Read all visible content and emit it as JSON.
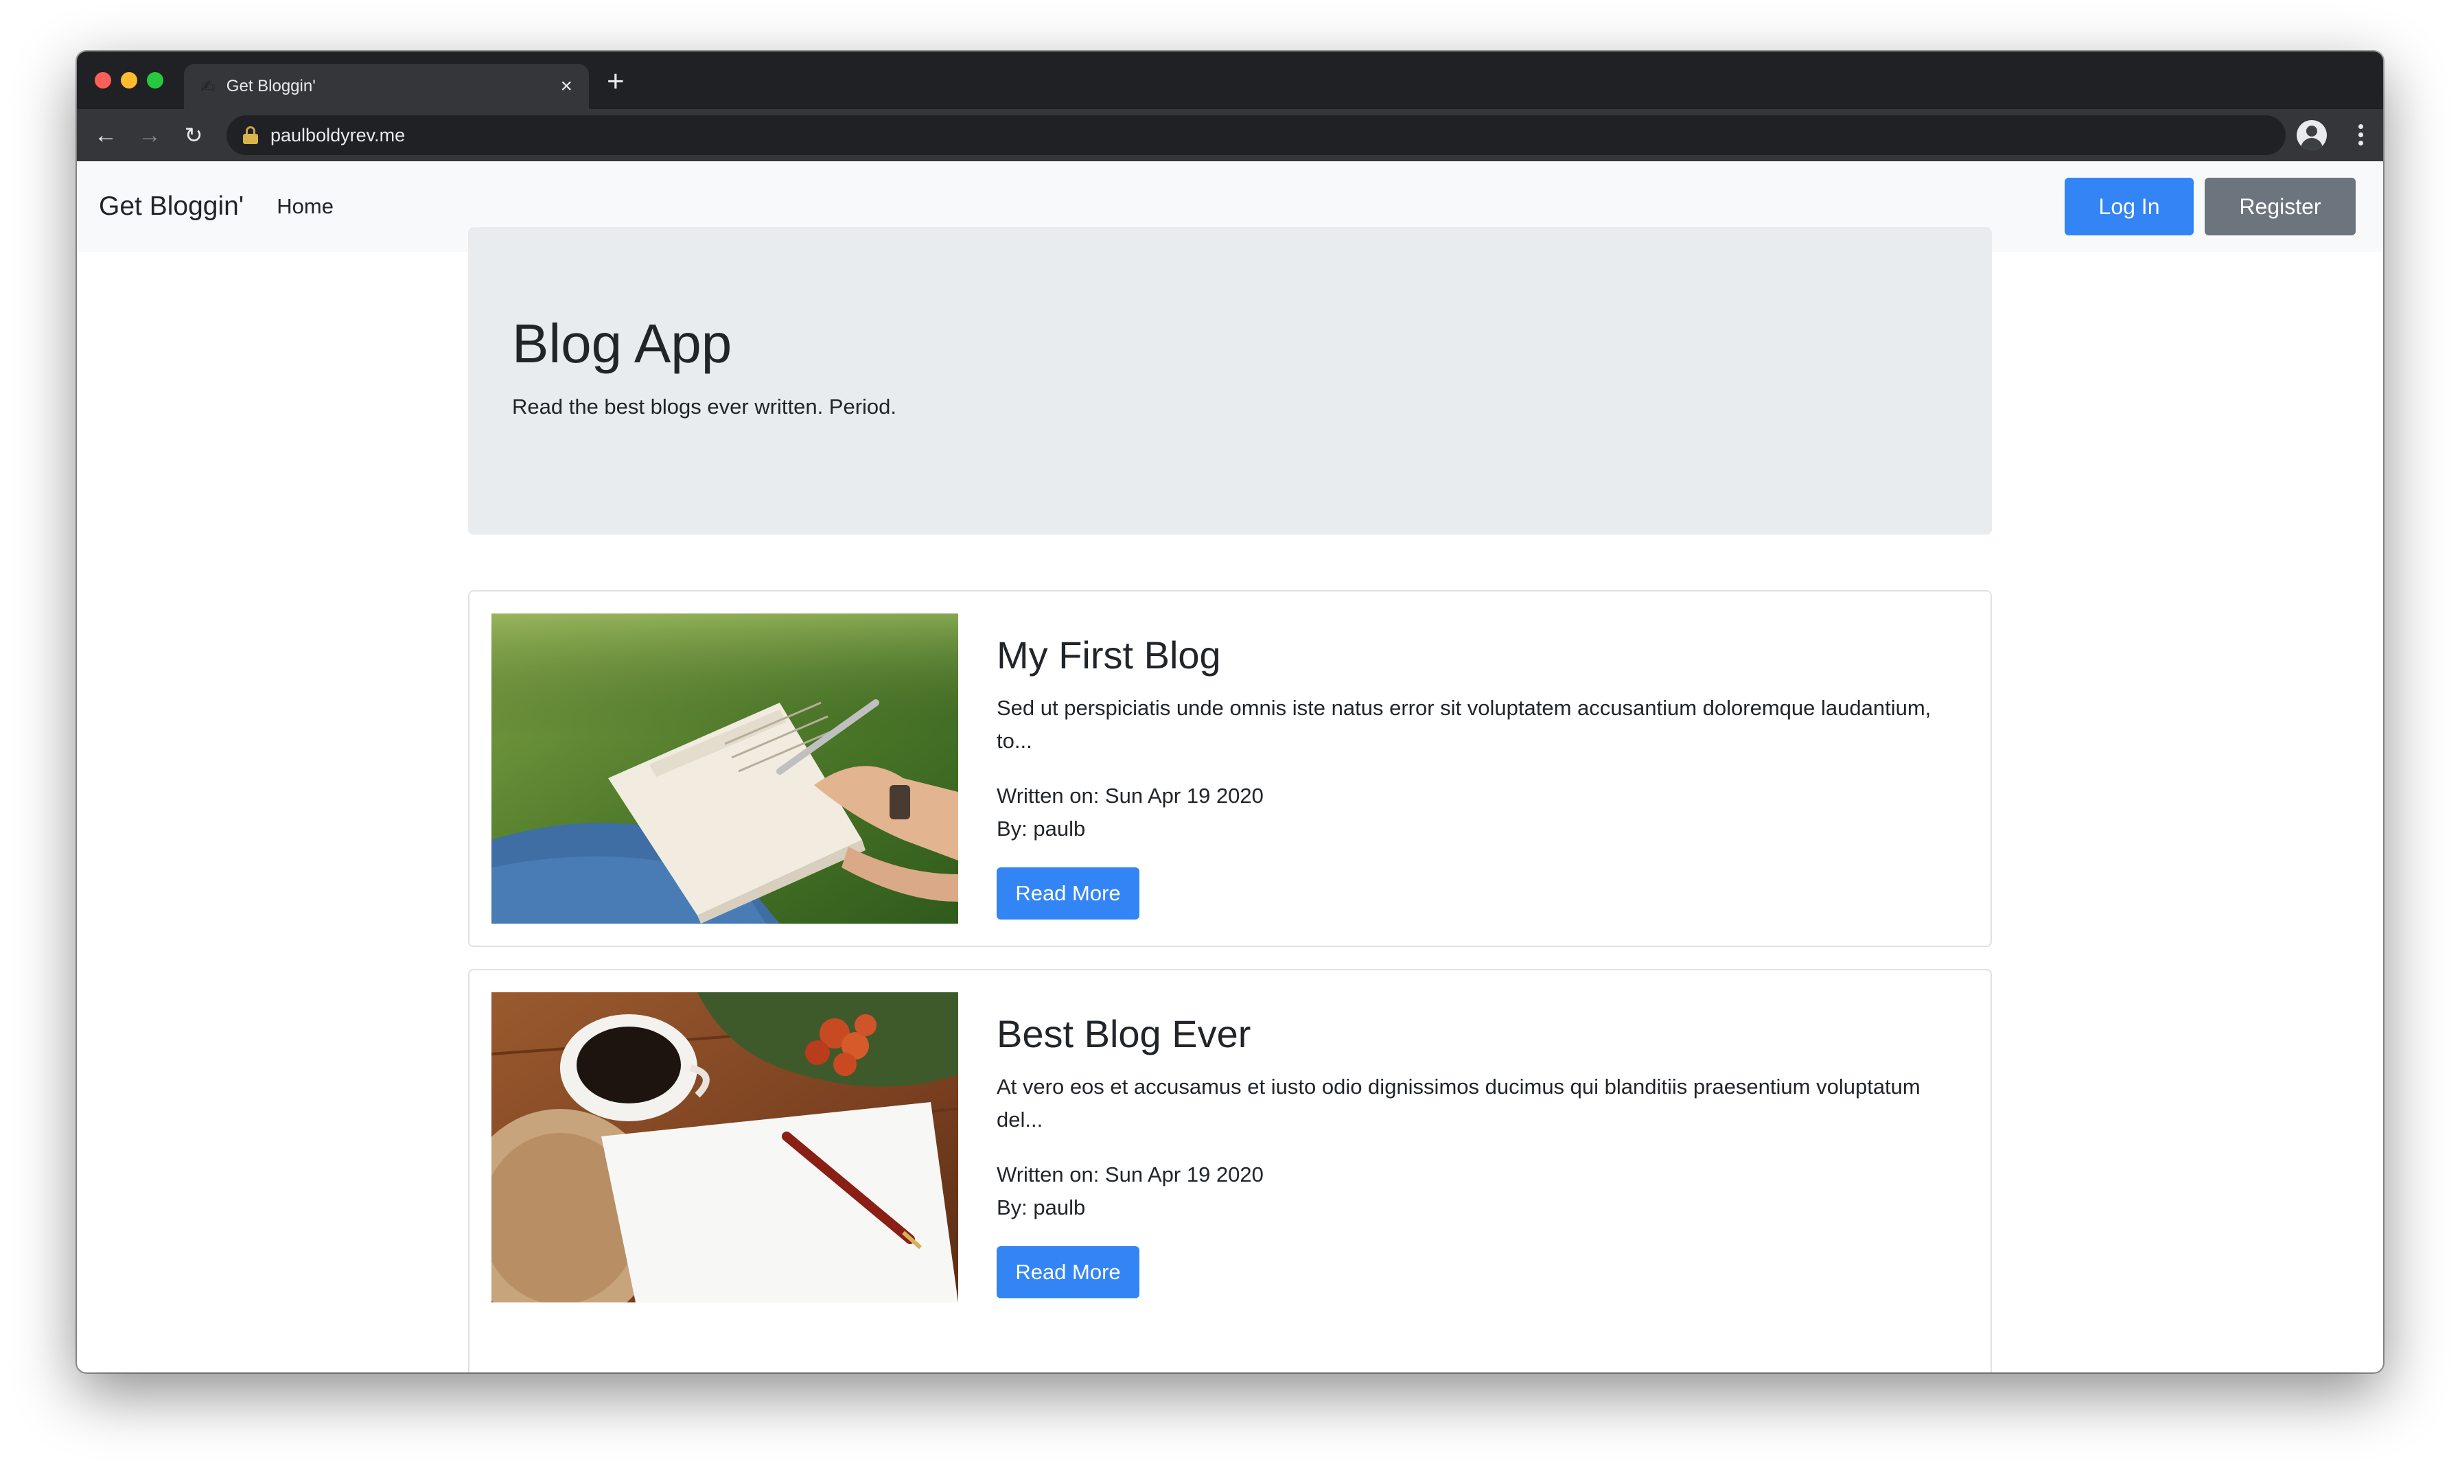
{
  "browser": {
    "tab_title": "Get Bloggin'",
    "tab_favicon": "✍",
    "url": "paulboldyrev.me",
    "icons": [
      "back-arrow-icon",
      "forward-arrow-icon",
      "reload-icon",
      "lock-icon",
      "profile-avatar-icon",
      "kebab-menu-icon",
      "close-icon",
      "plus-icon"
    ]
  },
  "navbar": {
    "brand": "Get Bloggin'",
    "home": "Home",
    "login_label": "Log In",
    "register_label": "Register"
  },
  "jumbotron": {
    "title": "Blog App",
    "lead": "Read the best blogs ever written. Period."
  },
  "posts": [
    {
      "title": "My First Blog",
      "excerpt": "Sed ut perspiciatis unde omnis iste natus error sit voluptatem accusantium doloremque laudantium, to...",
      "written": "Written on: Sun Apr 19 2020",
      "author": "By: paulb",
      "button": "Read More",
      "image": "person-writing-in-notebook-on-grass"
    },
    {
      "title": "Best Blog Ever",
      "excerpt": "At vero eos et accusamus et iusto odio dignissimos ducimus qui blanditiis praesentium voluptatum del...",
      "written": "Written on: Sun Apr 19 2020",
      "author": "By: paulb",
      "button": "Read More",
      "image": "coffee-cup-paper-and-pen-on-table"
    }
  ],
  "colors": {
    "primary": "#3385f5",
    "secondary": "#6c757d",
    "navbar_bg": "#f8f9fa",
    "jumbotron_bg": "#e9ecef",
    "chrome_dark": "#202124"
  }
}
